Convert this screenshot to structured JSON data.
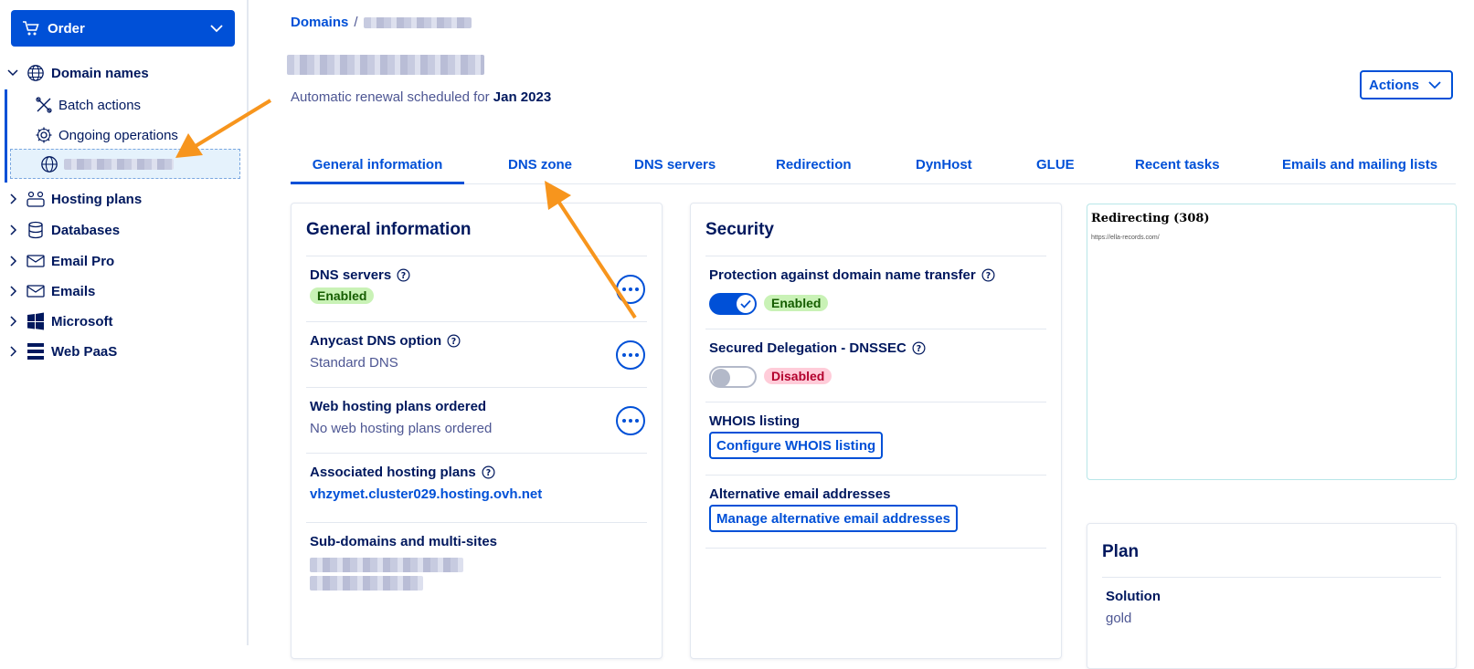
{
  "sidebar": {
    "order_label": "Order",
    "domain_names_label": "Domain names",
    "sub_items": [
      {
        "label": "Batch actions"
      },
      {
        "label": "Ongoing operations"
      }
    ],
    "nav": [
      {
        "label": "Hosting plans"
      },
      {
        "label": "Databases"
      },
      {
        "label": "Email Pro"
      },
      {
        "label": "Emails"
      },
      {
        "label": "Microsoft"
      },
      {
        "label": "Web PaaS"
      }
    ]
  },
  "header": {
    "breadcrumb_root": "Domains",
    "breadcrumb_sep": "/",
    "renewal_text": "Automatic renewal scheduled for",
    "renewal_date": "Jan 2023",
    "actions_label": "Actions"
  },
  "tabs": [
    {
      "label": "General information"
    },
    {
      "label": "DNS zone"
    },
    {
      "label": "DNS servers"
    },
    {
      "label": "Redirection"
    },
    {
      "label": "DynHost"
    },
    {
      "label": "GLUE"
    },
    {
      "label": "Recent tasks"
    },
    {
      "label": "Emails and mailing lists"
    }
  ],
  "general": {
    "title": "General information",
    "dns_servers_label": "DNS servers",
    "dns_servers_status": "Enabled",
    "anycast_label": "Anycast DNS option",
    "anycast_value": "Standard DNS",
    "web_hosting_label": "Web hosting plans ordered",
    "web_hosting_value": "No web hosting plans ordered",
    "associated_label": "Associated hosting plans",
    "associated_value": "vhzymet.cluster029.hosting.ovh.net",
    "subdomains_label": "Sub-domains and multi-sites"
  },
  "security": {
    "title": "Security",
    "protection_label": "Protection against domain name transfer",
    "protection_status": "Enabled",
    "dnssec_label": "Secured Delegation - DNSSEC",
    "dnssec_status": "Disabled",
    "whois_label": "WHOIS listing",
    "whois_button": "Configure WHOIS listing",
    "alt_email_label": "Alternative email addresses",
    "alt_email_button": "Manage alternative email addresses"
  },
  "redirect_preview": {
    "title": "Redirecting (308)",
    "url": "https://ella-records.com/"
  },
  "plan": {
    "title": "Plan",
    "solution_label": "Solution",
    "solution_value": "gold"
  },
  "colors": {
    "primary": "#0050d7",
    "text_dark": "#00185e",
    "annotation_arrow": "#f7951d",
    "enabled_bg": "#c9f2b6",
    "disabled_bg": "#ffccd9"
  }
}
